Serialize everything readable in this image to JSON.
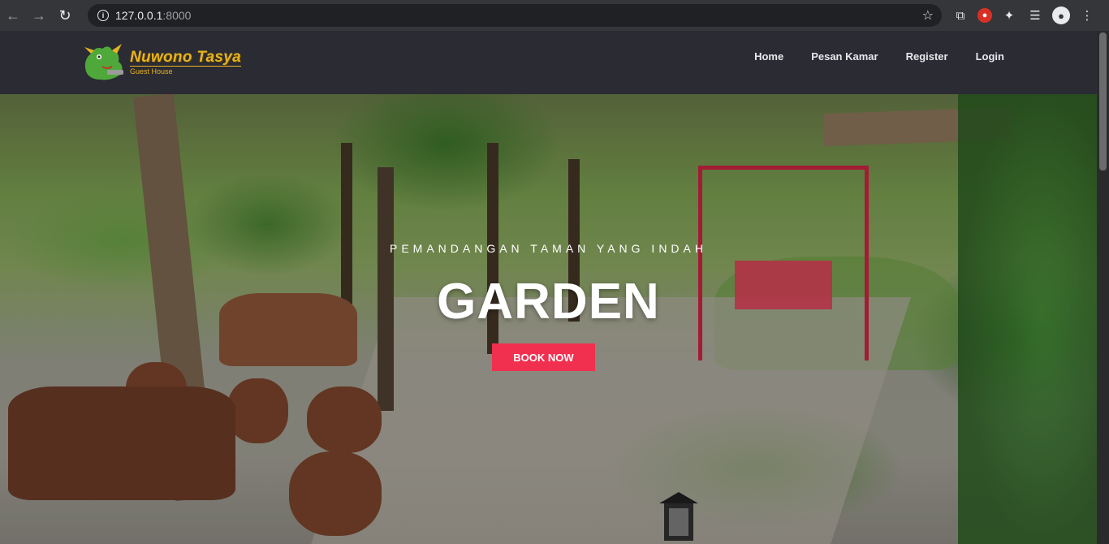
{
  "browser": {
    "url_host": "127.0.0.1",
    "url_port": ":8000",
    "back_icon": "arrow-left-icon",
    "forward_icon": "arrow-right-icon",
    "reload_icon": "reload-icon"
  },
  "site": {
    "logo_title": "Nuwono Tasya",
    "logo_subtitle": "Guest House",
    "nav": [
      "Home",
      "Pesan Kamar",
      "Register",
      "Login"
    ]
  },
  "hero": {
    "kicker": "PEMANDANGAN TAMAN YANG INDAH",
    "title": "GARDEN",
    "button_label": "BOOK NOW"
  },
  "colors": {
    "header_bg": "#2b2b33",
    "accent": "#f1304f",
    "logo_gold": "#e6b422"
  }
}
